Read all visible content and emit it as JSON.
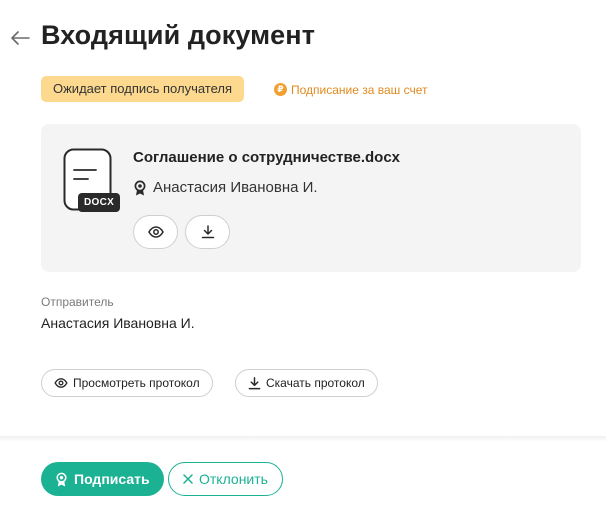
{
  "header": {
    "title": "Входящий документ",
    "back_icon": "arrow-left-icon"
  },
  "status": {
    "badge": "Ожидает подпись получателя",
    "payment_note": "Подписание за ваш счет",
    "payment_icon_glyph": "₽",
    "badge_color": "#fcd98e",
    "note_color": "#e08a1e"
  },
  "document": {
    "file_name": "Соглашение о сотрудничестве.docx",
    "file_ext": "DOCX",
    "signer": "Анастасия Ивановна И.",
    "signer_icon": "certificate-icon",
    "view_icon": "eye-icon",
    "download_icon": "download-icon"
  },
  "sender": {
    "label": "Отправитель",
    "name": "Анастасия Ивановна И."
  },
  "protocol": {
    "view_label": "Просмотреть протокол",
    "download_label": "Скачать протокол"
  },
  "actions": {
    "sign_label": "Подписать",
    "reject_label": "Отклонить",
    "accent_color": "#1bb294"
  }
}
